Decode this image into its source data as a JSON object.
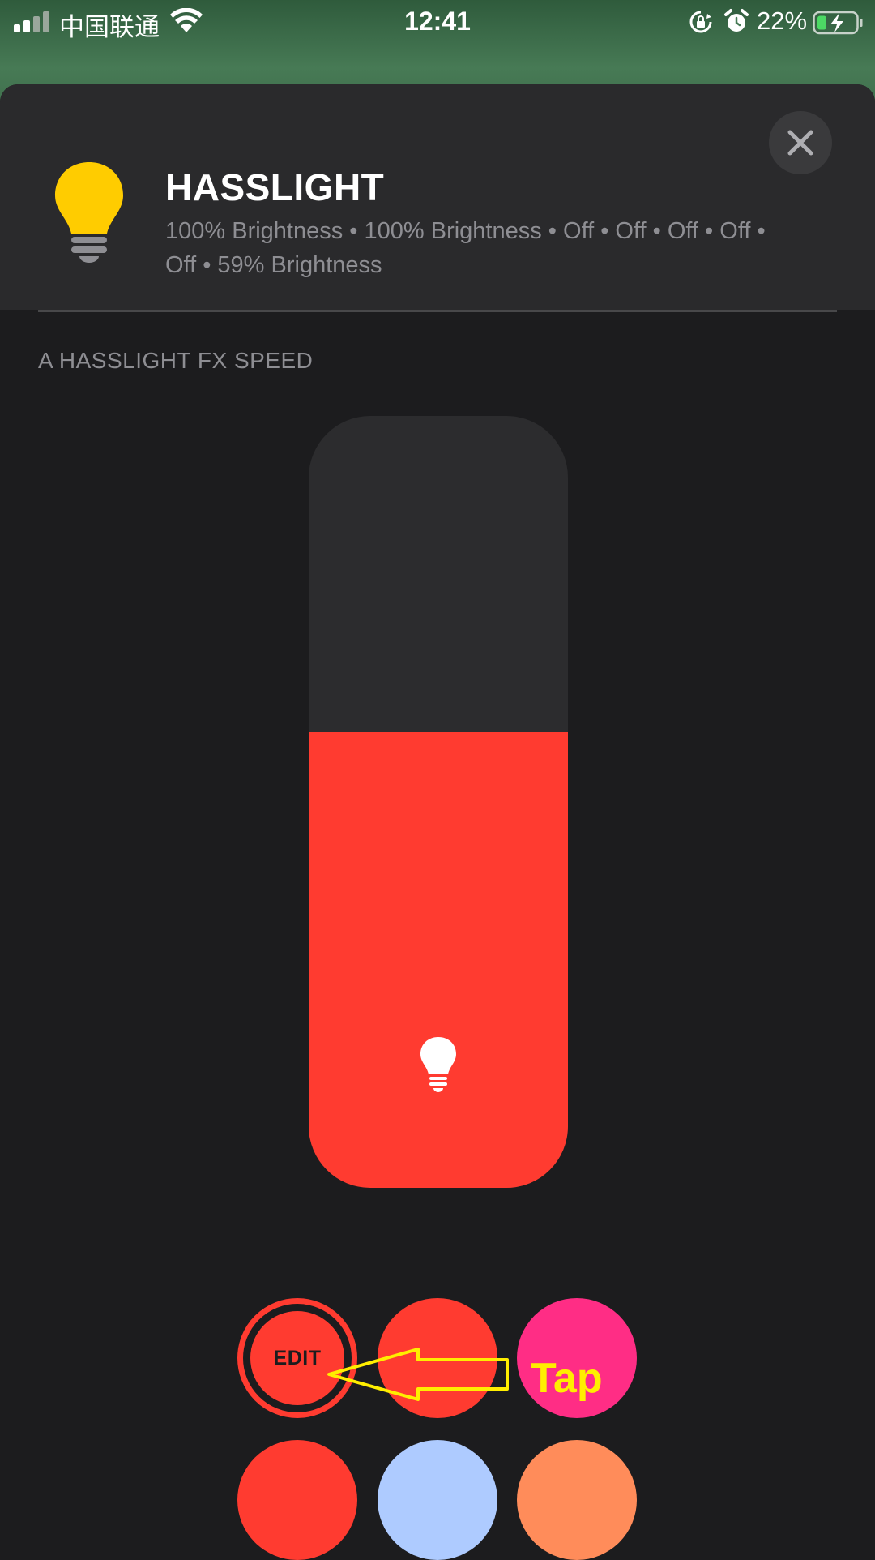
{
  "status_bar": {
    "carrier": "中国联通",
    "time": "12:41",
    "battery_percent": "22%"
  },
  "accessory": {
    "name": "HASSLIGHT",
    "status_line": "100% Brightness • 100% Brightness • Off • Off • Off • Off • Off • 59% Brightness",
    "icon": "lightbulb-icon",
    "icon_color": "#ffcc00"
  },
  "section": {
    "label": "A HASSLIGHT FX SPEED"
  },
  "slider": {
    "level_percent": 59,
    "fill_color": "#ff3b30",
    "track_color": "#2c2c2e",
    "icon": "lightbulb-icon"
  },
  "swatches": [
    {
      "id": "edit",
      "label": "EDIT",
      "color": "#ff3b30",
      "selected": true
    },
    {
      "id": "red",
      "color": "#ff3b30"
    },
    {
      "id": "pink",
      "color": "#ff2d85"
    },
    {
      "id": "red-2",
      "color": "#ff3b30"
    },
    {
      "id": "light-blue",
      "color": "#aecbff"
    },
    {
      "id": "orange",
      "color": "#ff8c5a"
    }
  ],
  "annotation": {
    "text": "Tap",
    "color": "#ffee00"
  }
}
